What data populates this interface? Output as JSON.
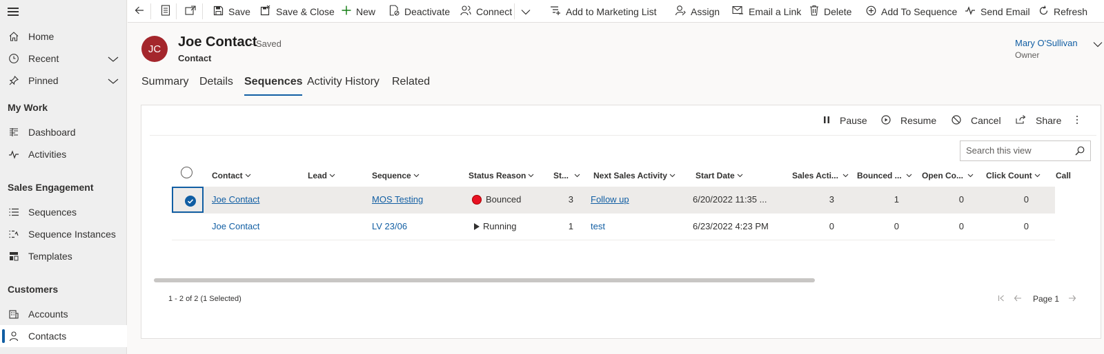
{
  "sidebar": {
    "items": [
      {
        "label": "Home",
        "icon": "home-icon"
      },
      {
        "label": "Recent",
        "icon": "clock-icon"
      },
      {
        "label": "Pinned",
        "icon": "pin-icon"
      }
    ],
    "sections": [
      {
        "title": "My Work",
        "items": [
          {
            "label": "Dashboard"
          },
          {
            "label": "Activities"
          }
        ]
      },
      {
        "title": "Sales Engagement",
        "items": [
          {
            "label": "Sequences"
          },
          {
            "label": "Sequence Instances"
          },
          {
            "label": "Templates"
          }
        ]
      },
      {
        "title": "Customers",
        "items": [
          {
            "label": "Accounts"
          },
          {
            "label": "Contacts"
          }
        ]
      }
    ]
  },
  "toolbar": {
    "save": "Save",
    "save_close": "Save & Close",
    "new": "New",
    "deactivate": "Deactivate",
    "connect": "Connect",
    "add_marketing": "Add to Marketing List",
    "assign": "Assign",
    "email_link": "Email a Link",
    "delete": "Delete",
    "add_sequence": "Add To Sequence",
    "send_email": "Send Email",
    "refresh": "Refresh"
  },
  "record": {
    "initials": "JC",
    "title": "Joe Contact",
    "saved": "- Saved",
    "entity": "Contact",
    "owner_name": "Mary O'Sullivan",
    "owner_label": "Owner"
  },
  "tabs": [
    "Summary",
    "Details",
    "Sequences",
    "Activity History",
    "Related"
  ],
  "active_tab": "Sequences",
  "grid": {
    "actions": {
      "pause": "Pause",
      "resume": "Resume",
      "cancel": "Cancel",
      "share": "Share"
    },
    "search_placeholder": "Search this view",
    "columns": [
      "Contact",
      "Lead",
      "Sequence",
      "Status Reason",
      "St...",
      "Next Sales Activity",
      "Start Date",
      "Sales Acti...",
      "Bounced ...",
      "Open Co...",
      "Click Count",
      "Call"
    ],
    "rows": [
      {
        "contact": "Joe Contact",
        "lead": "",
        "sequence": "MOS Testing",
        "status": "Bounced",
        "step": "3",
        "next_activity": "Follow up",
        "start_date": "6/20/2022 11:35 ...",
        "sales_activities": "3",
        "bounced": "1",
        "open_count": "0",
        "click_count": "0",
        "selected": true
      },
      {
        "contact": "Joe Contact",
        "lead": "",
        "sequence": "LV 23/06",
        "status": "Running",
        "step": "1",
        "next_activity": "test",
        "start_date": "6/23/2022 4:23 PM",
        "sales_activities": "0",
        "bounced": "0",
        "open_count": "0",
        "click_count": "0",
        "selected": false
      }
    ],
    "footer_count": "1 - 2 of 2 (1 Selected)",
    "page_label": "Page 1"
  },
  "colors": {
    "accent": "#115ea3",
    "avatar": "#a4262c",
    "bounced": "#e81123"
  }
}
